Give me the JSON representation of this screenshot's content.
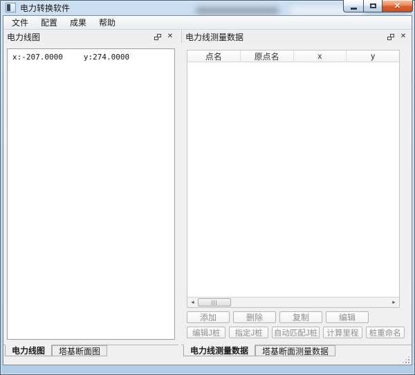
{
  "window": {
    "title": "电力转换软件"
  },
  "menu": {
    "items": [
      "文件",
      "配置",
      "成果",
      "帮助"
    ]
  },
  "left_panel": {
    "header": "电力线图",
    "canvas": {
      "coord_x": "x:-207.0000",
      "coord_y": "y:274.0000"
    },
    "tabs": [
      {
        "label": "电力线图",
        "active": true
      },
      {
        "label": "塔基断面图",
        "active": false
      }
    ]
  },
  "right_panel": {
    "header": "电力线测量数据",
    "table": {
      "columns": [
        "点名",
        "原点名",
        "x",
        "y"
      ],
      "rows": []
    },
    "buttons_row1": [
      "添加",
      "删除",
      "复制",
      "编辑"
    ],
    "buttons_row2": [
      "编辑J桩",
      "指定J桩",
      "自动匹配J桩",
      "计算里程",
      "桩重命名"
    ],
    "tabs": [
      {
        "label": "电力线测量数据",
        "active": true
      },
      {
        "label": "塔基断面测量数据",
        "active": false
      }
    ]
  },
  "icons": {
    "close_glyph": "✕",
    "scroll_left": "◄",
    "scroll_right": "►",
    "dock_close": "✕"
  },
  "colors": {
    "glass": "#bdd3ea",
    "content_bg": "#f0f0f0",
    "close_button": "#d9602f"
  }
}
